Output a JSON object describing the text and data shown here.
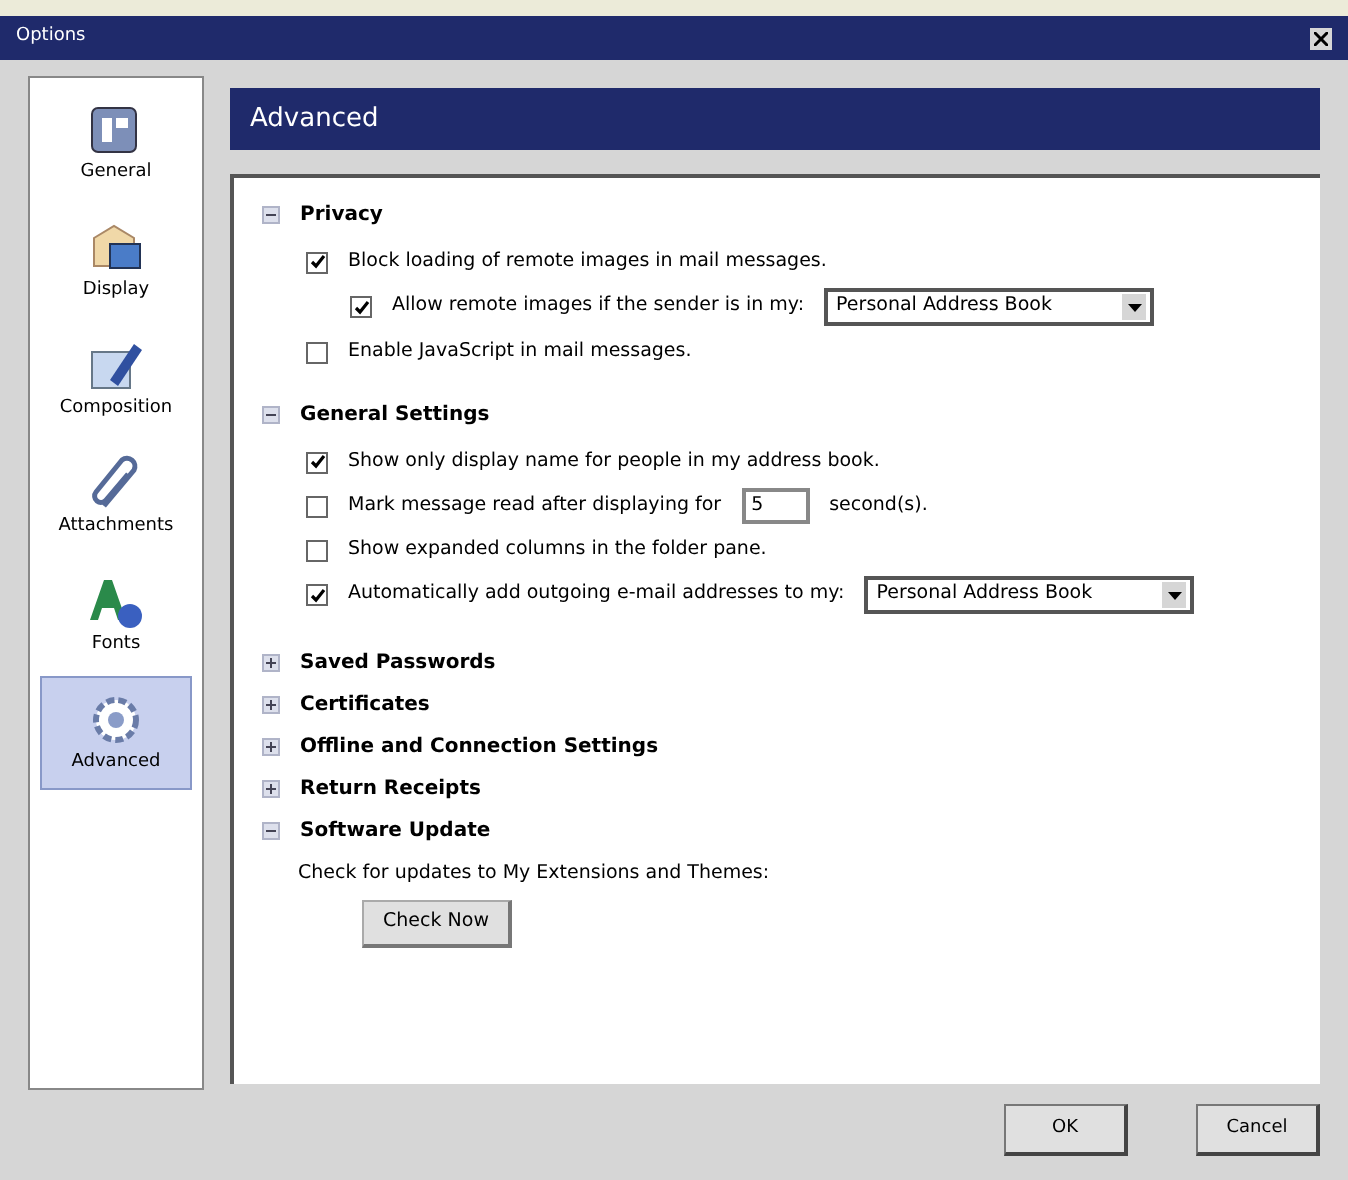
{
  "window": {
    "title": "Options"
  },
  "sidebar": {
    "items": [
      {
        "label": "General",
        "selected": false
      },
      {
        "label": "Display",
        "selected": false
      },
      {
        "label": "Composition",
        "selected": false
      },
      {
        "label": "Attachments",
        "selected": false
      },
      {
        "label": "Fonts",
        "selected": false
      },
      {
        "label": "Advanced",
        "selected": true
      }
    ]
  },
  "panel": {
    "title": "Advanced"
  },
  "sections": [
    {
      "title": "Privacy",
      "expanded": true,
      "items": [
        {
          "kind": "checkbox",
          "label": "Block loading of remote images in mail messages.",
          "checked": true,
          "children": [
            {
              "kind": "select",
              "label": "Allow remote images if the sender is in my:",
              "checked": true,
              "value": "Personal Address Book"
            }
          ]
        },
        {
          "kind": "checkbox",
          "label": "Enable JavaScript in mail messages.",
          "checked": false
        }
      ]
    },
    {
      "title": "General Settings",
      "expanded": true,
      "items": [
        {
          "kind": "checkbox",
          "label": "Show only display name for people in my address book.",
          "checked": true
        },
        {
          "kind": "input",
          "label": "Mark message read after displaying for",
          "checked": false,
          "value": "5",
          "suffix": "second(s)."
        },
        {
          "kind": "checkbox",
          "label": "Show expanded columns in the folder pane.",
          "checked": false
        },
        {
          "kind": "select",
          "label": "Automatically add outgoing e-mail addresses to my:",
          "checked": true,
          "value": "Personal Address Book"
        }
      ]
    },
    {
      "title": "Saved Passwords",
      "expanded": false
    },
    {
      "title": "Certificates",
      "expanded": false
    },
    {
      "title": "Offline and Connection Settings",
      "expanded": false
    },
    {
      "title": "Return Receipts",
      "expanded": false
    },
    {
      "title": "Software Update",
      "expanded": true,
      "items": [
        {
          "kind": "text",
          "label": "Check for updates to My Extensions and Themes:"
        },
        {
          "kind": "button",
          "label": "Check Now"
        }
      ]
    }
  ],
  "buttons": [
    "OK",
    "Cancel"
  ]
}
